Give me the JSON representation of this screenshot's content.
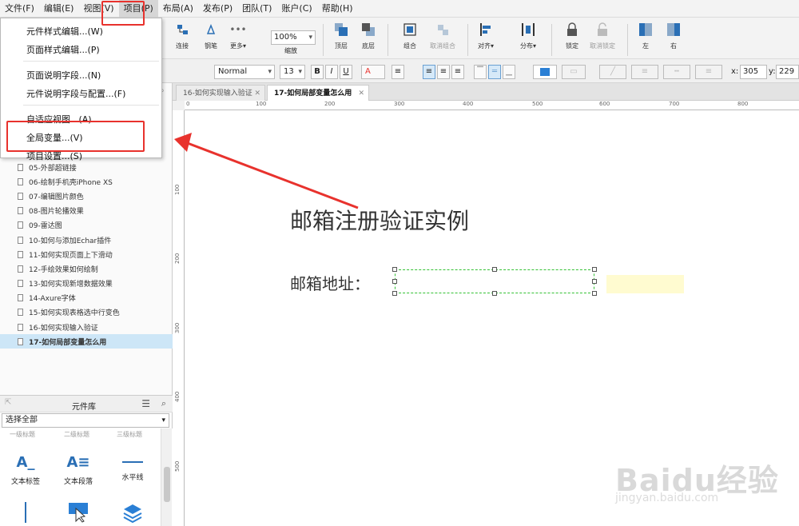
{
  "menu": {
    "items": [
      "文件(F)",
      "编辑(E)",
      "视图(V)",
      "项目(P)",
      "布局(A)",
      "发布(P)",
      "团队(T)",
      "账户(C)",
      "帮助(H)"
    ]
  },
  "toolbar": {
    "buttons": [
      "连接",
      "钢笔",
      "更多▾",
      "顶层",
      "底层",
      "组合",
      "取消组合",
      "对齐▾",
      "分布▾",
      "锁定",
      "取消锁定",
      "左",
      "右"
    ],
    "zoom": "100%",
    "zoom_label": "缩放"
  },
  "format": {
    "font_style": "Normal",
    "font_size": "13",
    "bold": "B",
    "italic": "I",
    "underline": "U",
    "font_color": "A",
    "x_label": "x:",
    "x_value": "305",
    "y_label": "y:",
    "y_value": "229"
  },
  "project_menu": {
    "items": [
      "元件样式编辑...(W)",
      "页面样式编辑...(P)",
      "页面说明字段...(N)",
      "元件说明字段与配置...(F)",
      "自适应视图...(A)",
      "全局变量...(V)",
      "项目设置...(S)"
    ]
  },
  "pages": [
    "05-外部超链接",
    "06-绘制手机壳iPhone XS",
    "07-编辑图片颜色",
    "08-图片轮播效果",
    "09-雷达图",
    "10-如何与添加Echar插件",
    "11-如何实现页面上下滑动",
    "12-手绘效果如何绘制",
    "13-如何实现新增数据效果",
    "14-Axure字体",
    "15-如何实现表格选中行变色",
    "16-如何实现输入验证",
    "17-如何局部变量怎么用"
  ],
  "library": {
    "title": "元件库",
    "selector": "选择全部",
    "top_labels": [
      "一级标题",
      "二级标题",
      "三级标题"
    ],
    "items": [
      "文本标签",
      "文本段落",
      "水平线"
    ]
  },
  "tabs": [
    "16-如何实现输入验证",
    "17-如何局部变量怎么用"
  ],
  "ruler": {
    "h": [
      "0",
      "100",
      "200",
      "300",
      "400",
      "500",
      "600",
      "700",
      "800"
    ],
    "v": [
      "100",
      "200",
      "300",
      "400",
      "500"
    ]
  },
  "canvas": {
    "heading": "邮箱注册验证实例",
    "email_label": "邮箱地址："
  },
  "watermark": {
    "main": "Baidu经验",
    "sub": "jingyan.baidu.com"
  },
  "colors": {
    "highlight_red": "#e8322d",
    "selected_page": "#cde6f7",
    "tip_box": "#fffbd0",
    "selection_green": "#34c234"
  }
}
